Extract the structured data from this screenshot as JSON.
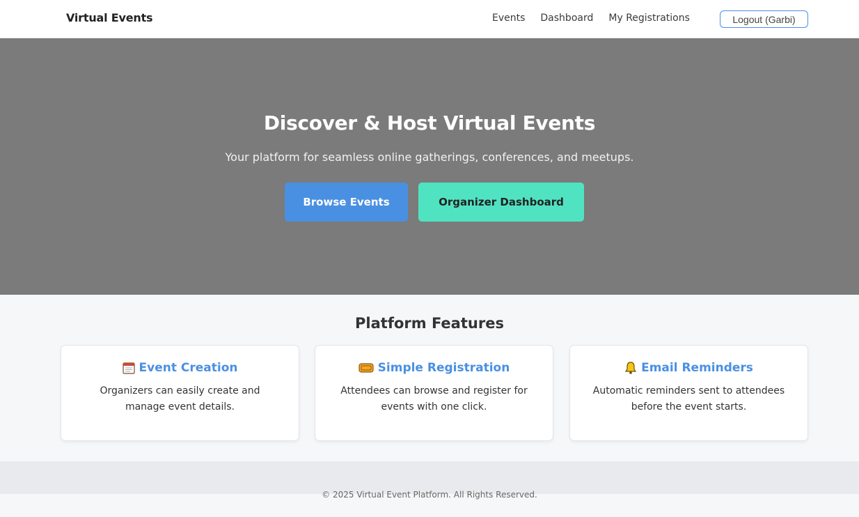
{
  "nav": {
    "brand": "Virtual Events",
    "links": [
      "Events",
      "Dashboard",
      "My Registrations"
    ],
    "logout_label": "Logout (Garbi)"
  },
  "hero": {
    "title": "Discover & Host Virtual Events",
    "subtitle": "Your platform for seamless online gatherings, conferences, and meetups.",
    "primary_button": "Browse Events",
    "secondary_button": "Organizer Dashboard"
  },
  "features": {
    "title": "Platform Features",
    "cards": [
      {
        "icon": "calendar-icon",
        "title": "Event Creation",
        "text": "Organizers can easily create and manage event details."
      },
      {
        "icon": "ticket-icon",
        "title": "Simple Registration",
        "text": "Attendees can browse and register for events with one click."
      },
      {
        "icon": "bell-icon",
        "title": "Email Reminders",
        "text": "Automatic reminders sent to attendees before the event starts."
      }
    ]
  },
  "footer": {
    "text": "© 2025 Virtual Event Platform. All Rights Reserved."
  },
  "colors": {
    "accent": "#4a90e2",
    "secondary": "#50e3c2",
    "hero_bg": "#7a7b7a"
  }
}
